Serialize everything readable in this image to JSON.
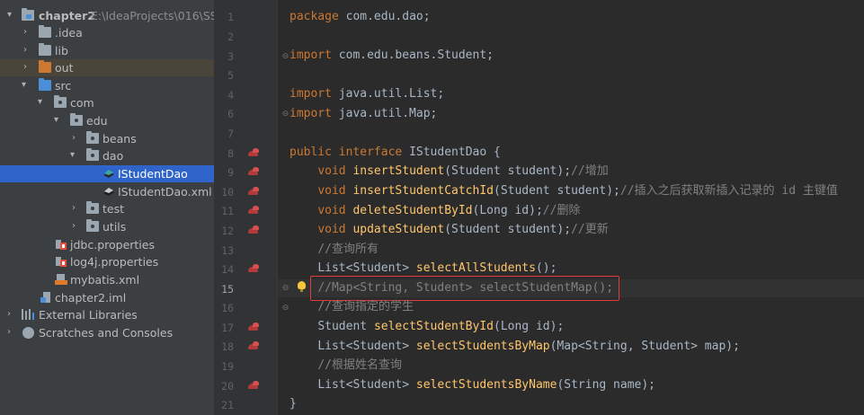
{
  "project_tree": {
    "root": {
      "name": "chapter2",
      "path": "E:\\IdeaProjects\\016\\SSM"
    },
    "items": [
      {
        "label": ".idea"
      },
      {
        "label": "lib"
      },
      {
        "label": "out"
      },
      {
        "label": "src"
      },
      {
        "label": "com"
      },
      {
        "label": "edu"
      },
      {
        "label": "beans"
      },
      {
        "label": "dao"
      },
      {
        "label": "IStudentDao"
      },
      {
        "label": "IStudentDao.xml"
      },
      {
        "label": "test"
      },
      {
        "label": "utils"
      },
      {
        "label": "jdbc.properties"
      },
      {
        "label": "log4j.properties"
      },
      {
        "label": "mybatis.xml"
      },
      {
        "label": "chapter2.iml"
      },
      {
        "label": "External Libraries"
      },
      {
        "label": "Scratches and Consoles"
      }
    ],
    "selected": "IStudentDao"
  },
  "editor": {
    "current_line": "15",
    "line_numbers": [
      "1",
      "2",
      "3",
      "4",
      "5",
      "6",
      "7",
      "8",
      "9",
      "10",
      "11",
      "12",
      "13",
      "14",
      "15",
      "16",
      "17",
      "18",
      "19",
      "20",
      "21"
    ],
    "lines": {
      "l1": {
        "kw": "package",
        "rest": " com.edu.dao;"
      },
      "l3": {
        "kw": "import",
        "rest": " com.edu.beans.Student;"
      },
      "l5": {
        "kw": "import",
        "rest": " java.util.List;"
      },
      "l6": {
        "kw": "import",
        "rest": " java.util.Map;"
      },
      "l8": {
        "kw1": "public",
        "kw2": "interface",
        "rest": " IStudentDao {"
      },
      "l9": {
        "kw": "void",
        "fn": "insertStudent",
        "args": "(Student student);",
        "cm": "//增加"
      },
      "l10": {
        "kw": "void",
        "fn": "insertStudentCatchId",
        "args": "(Student student);",
        "cm": "//插入之后获取新插入记录的 id 主键值"
      },
      "l11": {
        "kw": "void",
        "fn": "deleteStudentById",
        "args": "(Long id);",
        "cm": "//删除"
      },
      "l12": {
        "kw": "void",
        "fn": "updateStudent",
        "args": "(Student student);",
        "cm": "//更新"
      },
      "l13": {
        "cm": "//查询所有"
      },
      "l14": {
        "type": "List<Student>",
        "fn": "selectAllStudents",
        "args": "();"
      },
      "l15": {
        "cm": "//Map<String, Student> selectStudentMap();"
      },
      "l16": {
        "cm": "//查询指定的学生"
      },
      "l17": {
        "type": "Student",
        "fn": "selectStudentById",
        "args": "(Long id);"
      },
      "l18": {
        "type": "List<Student>",
        "fn": "selectStudentsByMap",
        "args": "(Map<String, Student> map);"
      },
      "l19": {
        "cm": "//根据姓名查询"
      },
      "l20": {
        "type": "List<Student>",
        "fn": "selectStudentsByName",
        "args": "(String name);"
      },
      "l21": {
        "rest": "}"
      }
    }
  },
  "colors": {
    "keyword": "#cc7832",
    "method": "#ffc66d",
    "comment": "#808080",
    "selection": "#2f65ca",
    "highlight_box": "#e03c3c"
  },
  "icons": [
    "folder-icon",
    "package-icon",
    "interface-icon",
    "xml-file-icon",
    "properties-file-icon",
    "library-icon",
    "scratches-icon",
    "gutter-implementation-icon",
    "lightbulb-icon"
  ]
}
